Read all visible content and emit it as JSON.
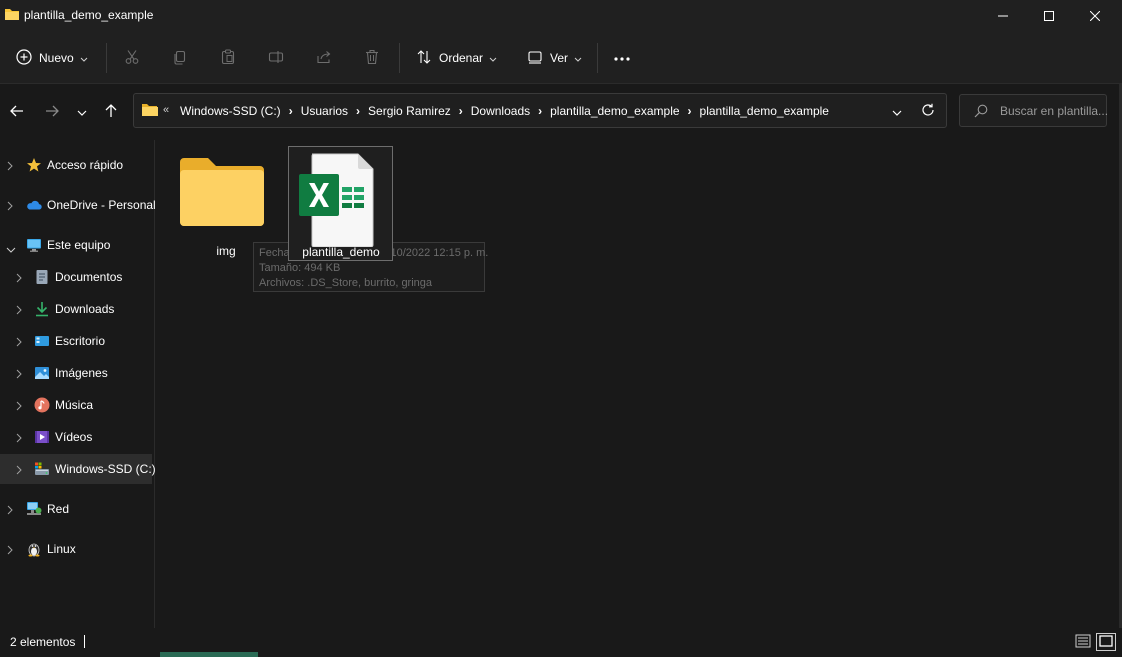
{
  "window": {
    "title": "plantilla_demo_example"
  },
  "toolbar": {
    "new_label": "Nuevo",
    "sort_label": "Ordenar",
    "view_label": "Ver",
    "icons": [
      "plus-circle-icon",
      "cut-icon",
      "copy-icon",
      "paste-icon",
      "rename-icon",
      "share-icon",
      "delete-icon",
      "sort-icon",
      "view-icon",
      "more-icon"
    ]
  },
  "address": {
    "overflow": "«",
    "crumbs": [
      "Windows-SSD (C:)",
      "Usuarios",
      "Sergio Ramirez",
      "Downloads",
      "plantilla_demo_example",
      "plantilla_demo_example"
    ]
  },
  "search": {
    "placeholder": "Buscar en plantilla..."
  },
  "sidebar": {
    "items": [
      {
        "label": "Acceso rápido",
        "icon": "star-icon"
      },
      {
        "label": "OneDrive - Personal",
        "icon": "cloud-icon"
      },
      {
        "label": "Este equipo",
        "icon": "monitor-icon"
      },
      {
        "label": "Documentos",
        "icon": "document-icon"
      },
      {
        "label": "Downloads",
        "icon": "download-icon"
      },
      {
        "label": "Escritorio",
        "icon": "desktop-icon"
      },
      {
        "label": "Imágenes",
        "icon": "image-icon"
      },
      {
        "label": "Música",
        "icon": "music-icon"
      },
      {
        "label": "Vídeos",
        "icon": "video-icon"
      },
      {
        "label": "Windows-SSD (C:)",
        "icon": "drive-icon"
      },
      {
        "label": "Red",
        "icon": "network-icon"
      },
      {
        "label": "Linux",
        "icon": "linux-icon"
      }
    ]
  },
  "files": [
    {
      "name": "img",
      "type": "folder"
    },
    {
      "name": "plantilla_demo",
      "type": "excel"
    }
  ],
  "tooltip": {
    "date": "Fecha de modificación: 10/10/2022 12:15 p. m.",
    "size": "Tamaño: 494 KB",
    "contents": "Archivos: .DS_Store, burrito, gringa"
  },
  "status": {
    "count": "2 elementos"
  },
  "colors": {
    "background": "#191919",
    "chrome": "#202020",
    "folder": "#f8c537",
    "excel_green": "#107c41",
    "selected": "#2d2d2d"
  }
}
